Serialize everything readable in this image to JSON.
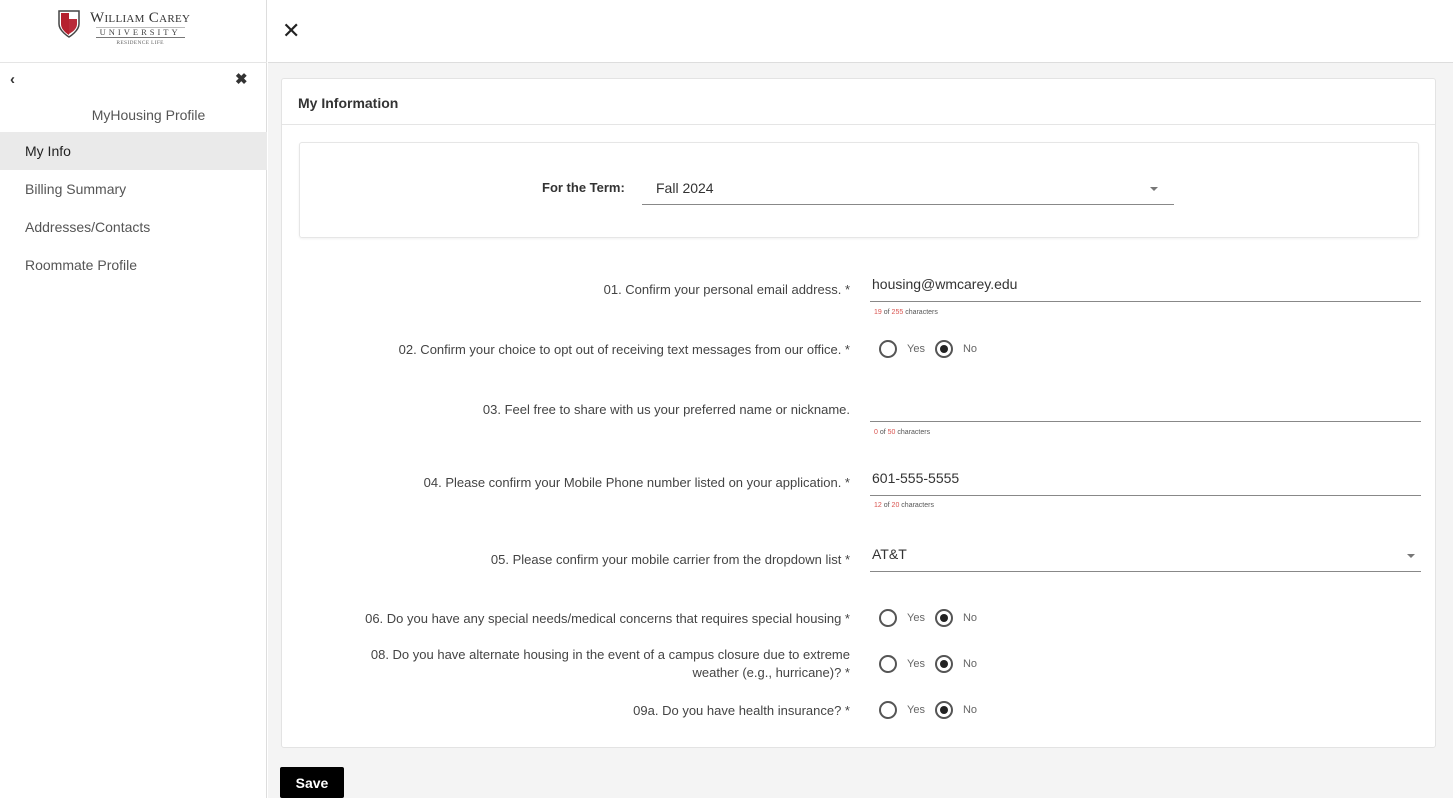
{
  "brand": {
    "name": "William Carey",
    "university": "UNIVERSITY",
    "sub": "RESIDENCE LIFE"
  },
  "sidebar": {
    "title": "MyHousing Profile",
    "items": [
      {
        "label": "My Info",
        "active": true
      },
      {
        "label": "Billing Summary"
      },
      {
        "label": "Addresses/Contacts"
      },
      {
        "label": "Roommate Profile"
      }
    ]
  },
  "card": {
    "title": "My Information",
    "term_label": "For the Term:",
    "term_value": "Fall 2024"
  },
  "questions": {
    "q1": {
      "label": "01. Confirm your personal email address. *",
      "value": "housing@wmcarey.edu",
      "count": "19",
      "max": "255",
      "suffix": "characters"
    },
    "q2": {
      "label": "02. Confirm your choice to opt out of receiving text messages from our office. *",
      "selected": "No"
    },
    "q3": {
      "label": "03. Feel free to share with us your preferred name or nickname.",
      "value": "",
      "count": "0",
      "max": "50",
      "suffix": "characters"
    },
    "q4": {
      "label": "04. Please confirm your Mobile Phone number listed on your application. *",
      "value": "601-555-5555",
      "count": "12",
      "max": "20",
      "suffix": "characters"
    },
    "q5": {
      "label": "05. Please confirm your mobile carrier from the dropdown list *",
      "value": "AT&T"
    },
    "q6": {
      "label": "06. Do you have any special needs/medical concerns that requires special housing *",
      "selected": "No"
    },
    "q8": {
      "label_line1": "08. Do you have alternate housing in the event of a campus closure due to extreme",
      "label_line2": "weather (e.g., hurricane)? *",
      "selected": "No"
    },
    "q9a": {
      "label": "09a. Do you have health insurance? *",
      "selected": "No"
    }
  },
  "radio": {
    "of": "of",
    "yes": "Yes",
    "no": "No"
  },
  "actions": {
    "save": "Save"
  },
  "icons": {
    "back": "chevron-left-icon",
    "close": "close-icon",
    "dropdown": "caret-down-icon",
    "logo": "shield-icon"
  },
  "colors": {
    "counter_highlight": "#d9534f",
    "save_bg": "#000000",
    "active_nav_bg": "#eaeaea"
  }
}
